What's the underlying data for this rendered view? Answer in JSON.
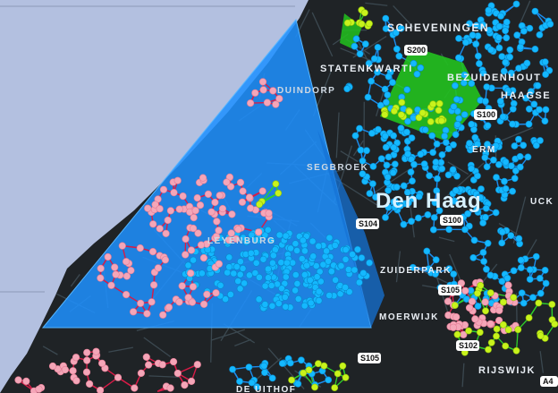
{
  "map": {
    "labels": {
      "scheveningen": "SCHEVENINGEN",
      "statenkwartier": "STATENKWARTI",
      "bezuidenhout": "BEZUIDENHOUT",
      "haagse": "HAAGSE",
      "duindorp": "DUINDORP",
      "segbroek": "SEGBROEK",
      "den_haag": "Den Haag",
      "luck": "UCK",
      "leyenburg": "LEYENBURG",
      "zuiderpark": "ZUIDERPARK",
      "moerwijk": "MOERWIJK",
      "rijswijk": "RIJSWIJK",
      "de_uithof": "DE UITHOF",
      "erm": "ERM"
    },
    "road_shields": {
      "s200": "S200",
      "s100a": "S100",
      "s100b": "S100",
      "s104": "S104",
      "s105a": "S105",
      "s105b": "S105",
      "s102": "S102",
      "a4": "A4"
    },
    "colors": {
      "sea": "#b3c0e0",
      "land": "#1f2326",
      "roads": "#3c4a52",
      "blue_cluster": "#1e90ff",
      "cyan_points": "#14b8ff",
      "pink_points": "#f4a6b8",
      "pink_lines": "#d81b47",
      "green_cluster": "#22c21f",
      "yellow_points": "#c8f31c"
    }
  }
}
